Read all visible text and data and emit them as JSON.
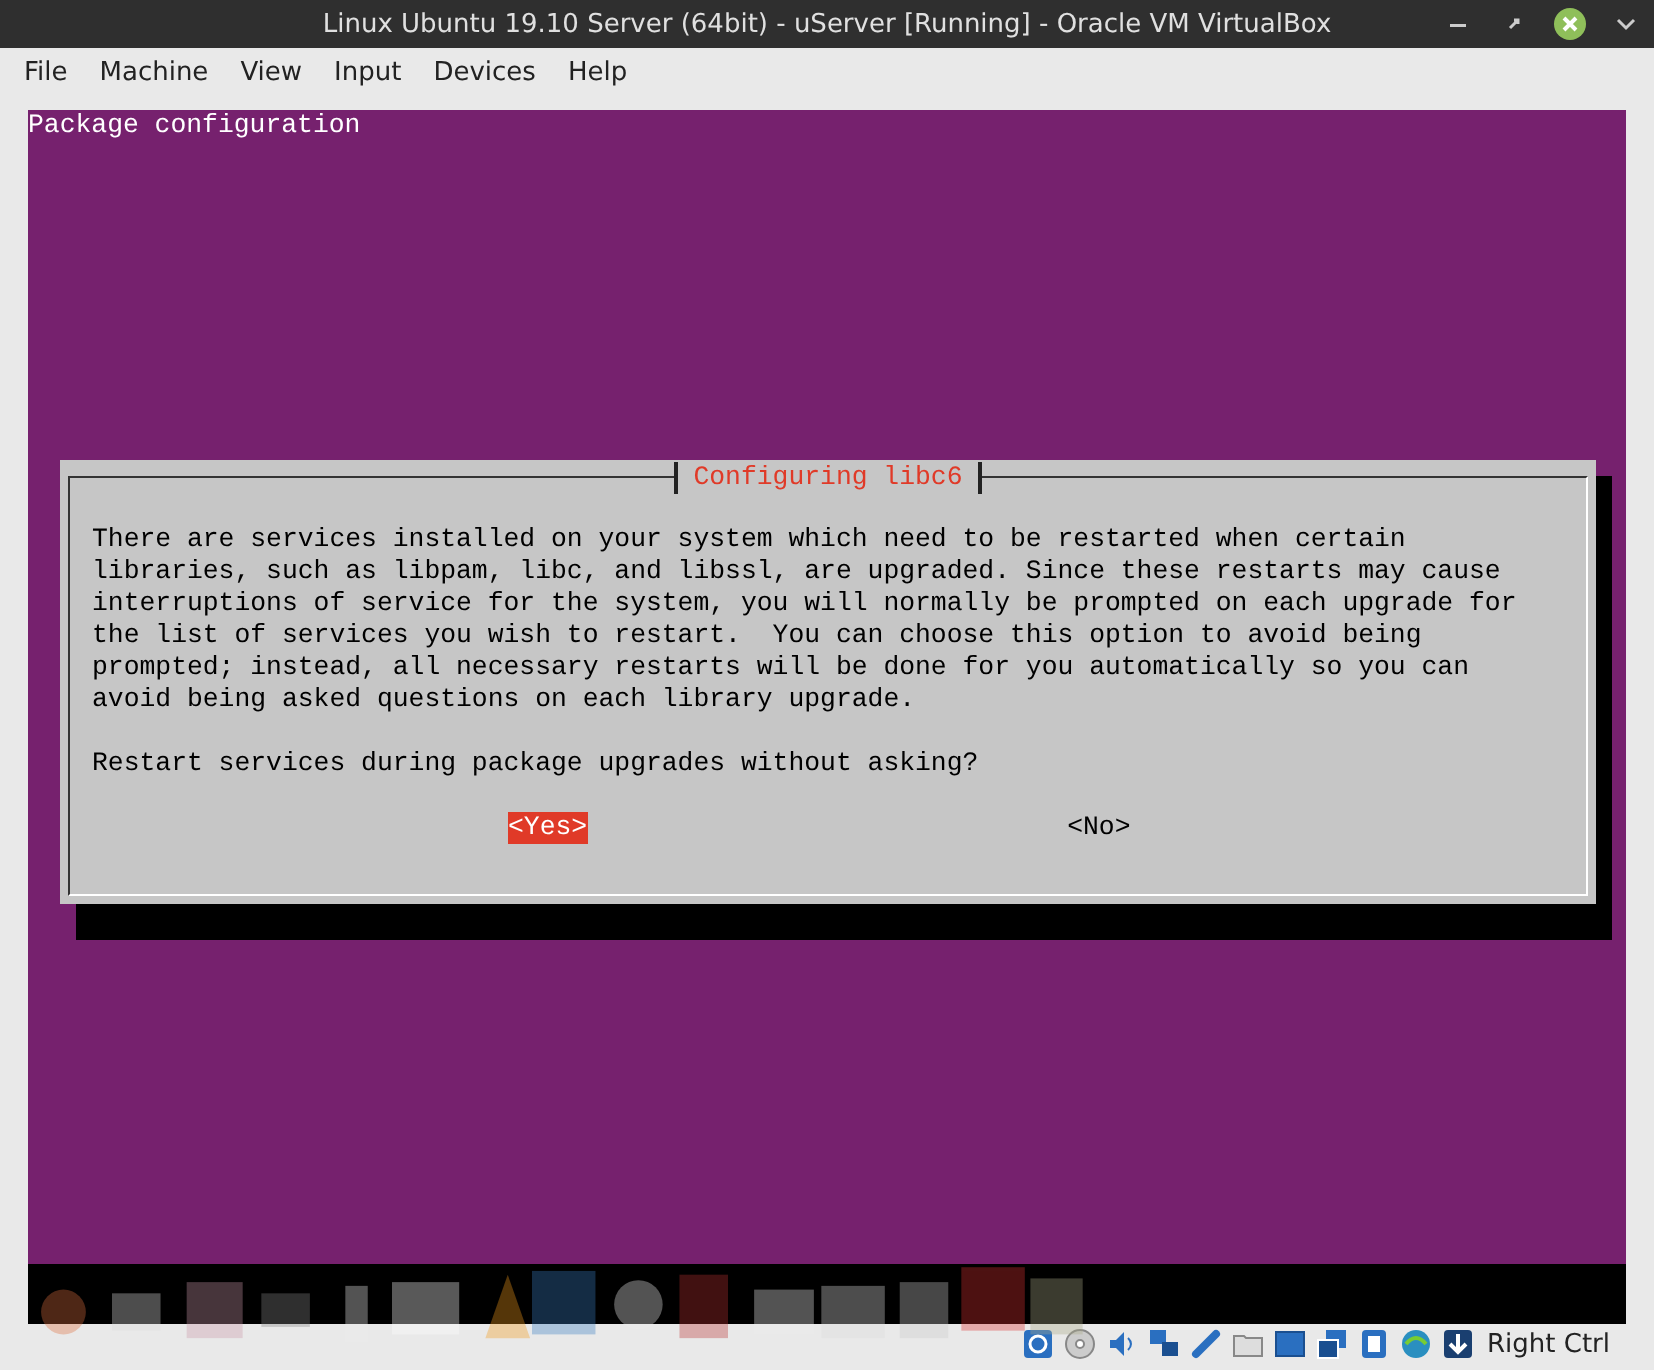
{
  "window": {
    "title": "Linux Ubuntu 19.10 Server (64bit) - uServer [Running] - Oracle VM VirtualBox"
  },
  "menu": [
    "File",
    "Machine",
    "View",
    "Input",
    "Devices",
    "Help"
  ],
  "console": {
    "header": "Package configuration",
    "dialog": {
      "title": "Configuring libc6",
      "message": "There are services installed on your system which need to be restarted when certain\nlibraries, such as libpam, libc, and libssl, are upgraded. Since these restarts may cause\ninterruptions of service for the system, you will normally be prompted on each upgrade for\nthe list of services you wish to restart.  You can choose this option to avoid being\nprompted; instead, all necessary restarts will be done for you automatically so you can\navoid being asked questions on each library upgrade.",
      "question": "Restart services during package upgrades without asking?",
      "buttons": [
        {
          "label": "<Yes>",
          "selected": true
        },
        {
          "label": "<No>",
          "selected": false
        }
      ]
    }
  },
  "status_bar": {
    "host_key": "Right Ctrl"
  }
}
